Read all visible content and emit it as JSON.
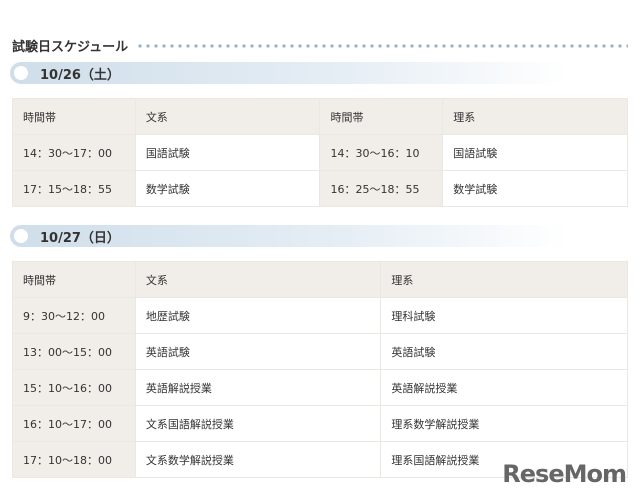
{
  "title": "試験日スケジュール",
  "day1": {
    "date": "10/26（土）",
    "headers": [
      "時間帯",
      "文系",
      "時間帯",
      "理系"
    ],
    "rows": [
      [
        "14：30〜17：00",
        "国語試験",
        "14：30〜16：10",
        "国語試験"
      ],
      [
        "17：15〜18：55",
        "数学試験",
        "16：25〜18：55",
        "数学試験"
      ]
    ]
  },
  "day2": {
    "date": "10/27（日）",
    "headers": [
      "時間帯",
      "文系",
      "理系"
    ],
    "rows": [
      [
        "9：30〜12：00",
        "地歴試験",
        "理科試験"
      ],
      [
        "13：00〜15：00",
        "英語試験",
        "英語試験"
      ],
      [
        "15：10〜16：00",
        "英語解説授業",
        "英語解説授業"
      ],
      [
        "16：10〜17：00",
        "文系国語解説授業",
        "理系数学解説授業"
      ],
      [
        "17：10〜18：00",
        "文系数学解説授業",
        "理系国語解説授業"
      ]
    ]
  },
  "logo": "ReseMom"
}
